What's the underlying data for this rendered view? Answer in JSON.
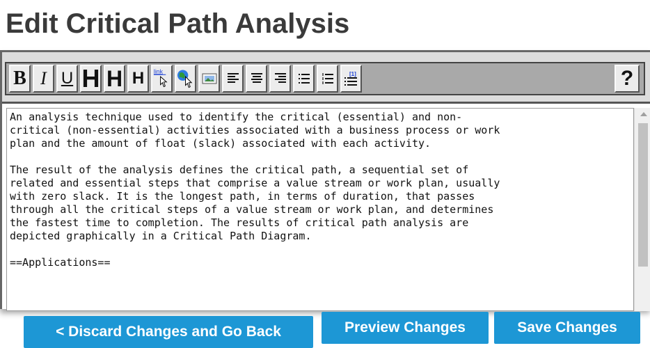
{
  "page": {
    "title": "Edit Critical Path Analysis"
  },
  "toolbar": {
    "buttons": [
      {
        "label": "B",
        "icon": "bold-icon"
      },
      {
        "label": "I",
        "icon": "italic-icon"
      },
      {
        "label": "U",
        "icon": "underline-icon"
      },
      {
        "label": "H",
        "icon": "heading-1-icon"
      },
      {
        "label": "H",
        "icon": "heading-2-icon"
      },
      {
        "label": "H",
        "icon": "heading-3-icon"
      },
      {
        "label": "link",
        "icon": "internal-link-icon"
      },
      {
        "icon": "external-link-icon"
      },
      {
        "icon": "image-icon"
      },
      {
        "icon": "align-left-icon"
      },
      {
        "icon": "align-center-icon"
      },
      {
        "icon": "align-right-icon"
      },
      {
        "icon": "bulleted-list-icon"
      },
      {
        "icon": "numbered-list-icon"
      },
      {
        "label": "[1]",
        "icon": "reference-icon"
      }
    ],
    "help_label": "?"
  },
  "editor": {
    "content": "An analysis technique used to identify the critical (essential) and non-\ncritical (non-essential) activities associated with a business process or work\nplan and the amount of float (slack) associated with each activity.\n\nThe result of the analysis defines the critical path, a sequential set of\nrelated and essential steps that comprise a value stream or work plan, usually\nwith zero slack. It is the longest path, in terms of duration, that passes\nthrough all the critical steps of a value stream or work plan, and determines\nthe fastest time to completion. The results of critical path analysis are\ndepicted graphically in a Critical Path Diagram.\n\n==Applications=="
  },
  "actions": {
    "discard_label": "< Discard Changes and Go Back",
    "preview_label": "Preview Changes",
    "save_label": "Save Changes"
  },
  "colors": {
    "button_blue": "#1d97d5",
    "title_gray": "#3a3a3a"
  }
}
